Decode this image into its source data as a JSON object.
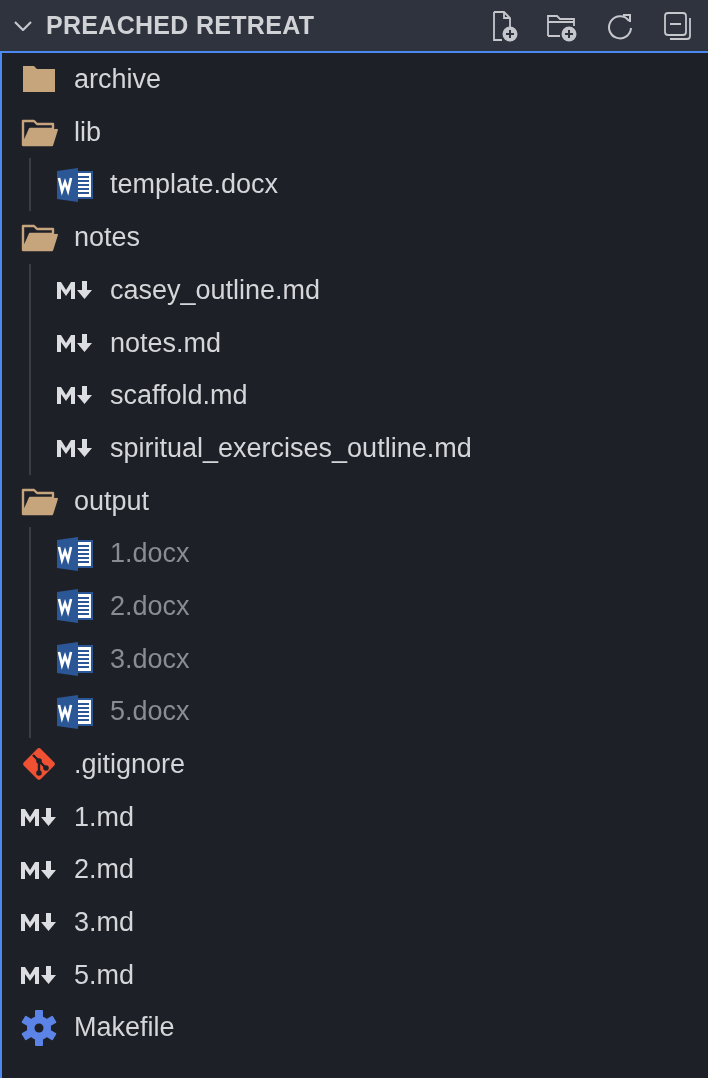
{
  "section": {
    "title": "PREACHED RETREAT",
    "expanded": true
  },
  "tree": [
    {
      "kind": "folder",
      "name": "archive",
      "expanded": false
    },
    {
      "kind": "folder",
      "name": "lib",
      "expanded": true,
      "children": [
        {
          "kind": "docx",
          "name": "template.docx",
          "dimmed": false
        }
      ]
    },
    {
      "kind": "folder",
      "name": "notes",
      "expanded": true,
      "children": [
        {
          "kind": "markdown",
          "name": "casey_outline.md",
          "dimmed": false
        },
        {
          "kind": "markdown",
          "name": "notes.md",
          "dimmed": false
        },
        {
          "kind": "markdown",
          "name": "scaffold.md",
          "dimmed": false
        },
        {
          "kind": "markdown",
          "name": "spiritual_exercises_outline.md",
          "dimmed": false
        }
      ]
    },
    {
      "kind": "folder",
      "name": "output",
      "expanded": true,
      "children": [
        {
          "kind": "docx",
          "name": "1.docx",
          "dimmed": true
        },
        {
          "kind": "docx",
          "name": "2.docx",
          "dimmed": true
        },
        {
          "kind": "docx",
          "name": "3.docx",
          "dimmed": true
        },
        {
          "kind": "docx",
          "name": "5.docx",
          "dimmed": true
        }
      ]
    },
    {
      "kind": "git",
      "name": ".gitignore",
      "dimmed": false
    },
    {
      "kind": "markdown",
      "name": "1.md",
      "dimmed": false
    },
    {
      "kind": "markdown",
      "name": "2.md",
      "dimmed": false
    },
    {
      "kind": "markdown",
      "name": "3.md",
      "dimmed": false
    },
    {
      "kind": "markdown",
      "name": "5.md",
      "dimmed": false
    },
    {
      "kind": "makefile",
      "name": "Makefile",
      "dimmed": false
    }
  ]
}
